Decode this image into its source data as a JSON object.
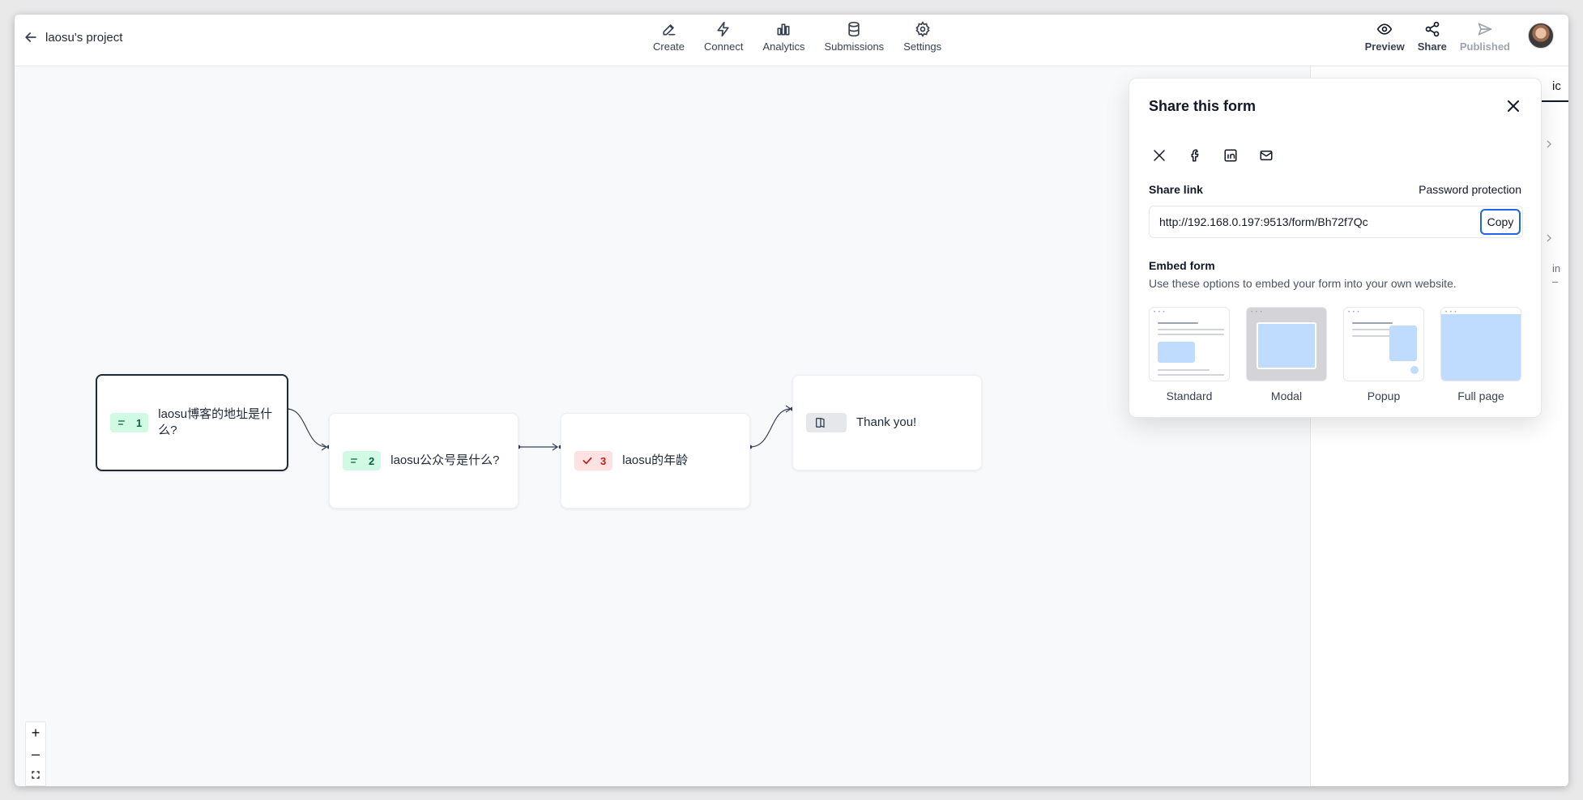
{
  "header": {
    "project_title": "laosu's project",
    "nav": [
      {
        "label": "Create",
        "icon": "pencil-icon"
      },
      {
        "label": "Connect",
        "icon": "lightning-icon"
      },
      {
        "label": "Analytics",
        "icon": "bar-chart-icon"
      },
      {
        "label": "Submissions",
        "icon": "database-icon"
      },
      {
        "label": "Settings",
        "icon": "gear-icon"
      }
    ],
    "actions": {
      "preview": "Preview",
      "share": "Share",
      "published": "Published"
    }
  },
  "side_panel": {
    "tab_fragment": "ic",
    "frag_text": "in",
    "frag_dash": "–"
  },
  "flow": {
    "nodes": [
      {
        "index": "1",
        "text": "laosu博客的地址是什么?",
        "type": "short-text"
      },
      {
        "index": "2",
        "text": "laosu公众号是什么?",
        "type": "short-text"
      },
      {
        "index": "3",
        "text": "laosu的年龄",
        "type": "yes-no"
      },
      {
        "index": "",
        "text": "Thank you!",
        "type": "ending"
      }
    ]
  },
  "zoom": {
    "plus": "+",
    "minus": "–"
  },
  "share_modal": {
    "title": "Share this form",
    "social": [
      "x-icon",
      "facebook-icon",
      "linkedin-icon",
      "mail-icon"
    ],
    "share_link_label": "Share link",
    "password_protection": "Password protection",
    "share_url": "http://192.168.0.197:9513/form/Bh72f7Qc",
    "copy_label": "Copy",
    "embed_title": "Embed form",
    "embed_desc": "Use these options to embed your form into your own website.",
    "embed_options": [
      "Standard",
      "Modal",
      "Popup",
      "Full page"
    ],
    "accent": "#2563eb",
    "embed_blue": "#bfdbfe"
  }
}
